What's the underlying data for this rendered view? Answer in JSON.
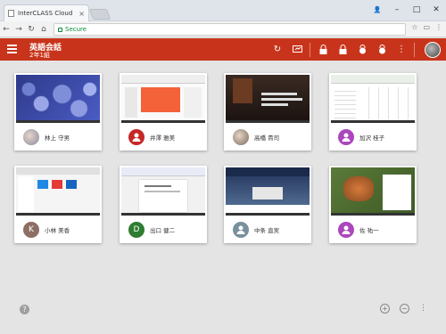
{
  "browser": {
    "tab_title": "InterCLASS Cloud",
    "tab_close": "×",
    "address_text": "Secure",
    "window_controls": {
      "minimize": "–",
      "maximize": "□",
      "close": "✕"
    },
    "nav": {
      "back": "←",
      "forward": "→",
      "reload": "↻",
      "home": "⌂"
    },
    "nav_right_icons": [
      "star-icon",
      "cast-icon",
      "menu-icon"
    ]
  },
  "app": {
    "accent": "#c8341b",
    "class_name": "英語会話",
    "class_sub": "2年1組",
    "toolbar_icons": [
      "refresh-icon",
      "screen-share-icon",
      "lock-icon",
      "lock-all-icon",
      "lock-student-icon",
      "lock-student-all-icon",
      "more-icon"
    ]
  },
  "students": [
    {
      "name": "林上 守男",
      "avatar_type": "photo",
      "avatar_color": "#8a8aa0",
      "initial": "",
      "thumb": "flowers"
    },
    {
      "name": "井澤 雅美",
      "avatar_type": "icon",
      "avatar_color": "#c62828",
      "initial": "",
      "thumb": "slides"
    },
    {
      "name": "高橋 貴司",
      "avatar_type": "photo",
      "avatar_color": "#7a6a5a",
      "initial": "",
      "thumb": "ancient"
    },
    {
      "name": "加沢 桂子",
      "avatar_type": "icon",
      "avatar_color": "#ab47bc",
      "initial": "",
      "thumb": "spreadsheet"
    },
    {
      "name": "小林 美香",
      "avatar_type": "letter",
      "avatar_color": "#8d6e63",
      "initial": "K",
      "thumb": "explorer"
    },
    {
      "name": "出口 健二",
      "avatar_type": "letter",
      "avatar_color": "#2e7d32",
      "initial": "D",
      "thumb": "document"
    },
    {
      "name": "中条 直実",
      "avatar_type": "icon",
      "avatar_color": "#78909c",
      "initial": "",
      "thumb": "whitehouse"
    },
    {
      "name": "佐 祐一",
      "avatar_type": "icon",
      "avatar_color": "#ab47bc",
      "initial": "",
      "thumb": "fox"
    }
  ],
  "footer": {
    "help": "?",
    "zoom_in": "+",
    "zoom_out": "−",
    "more": "⋮"
  }
}
